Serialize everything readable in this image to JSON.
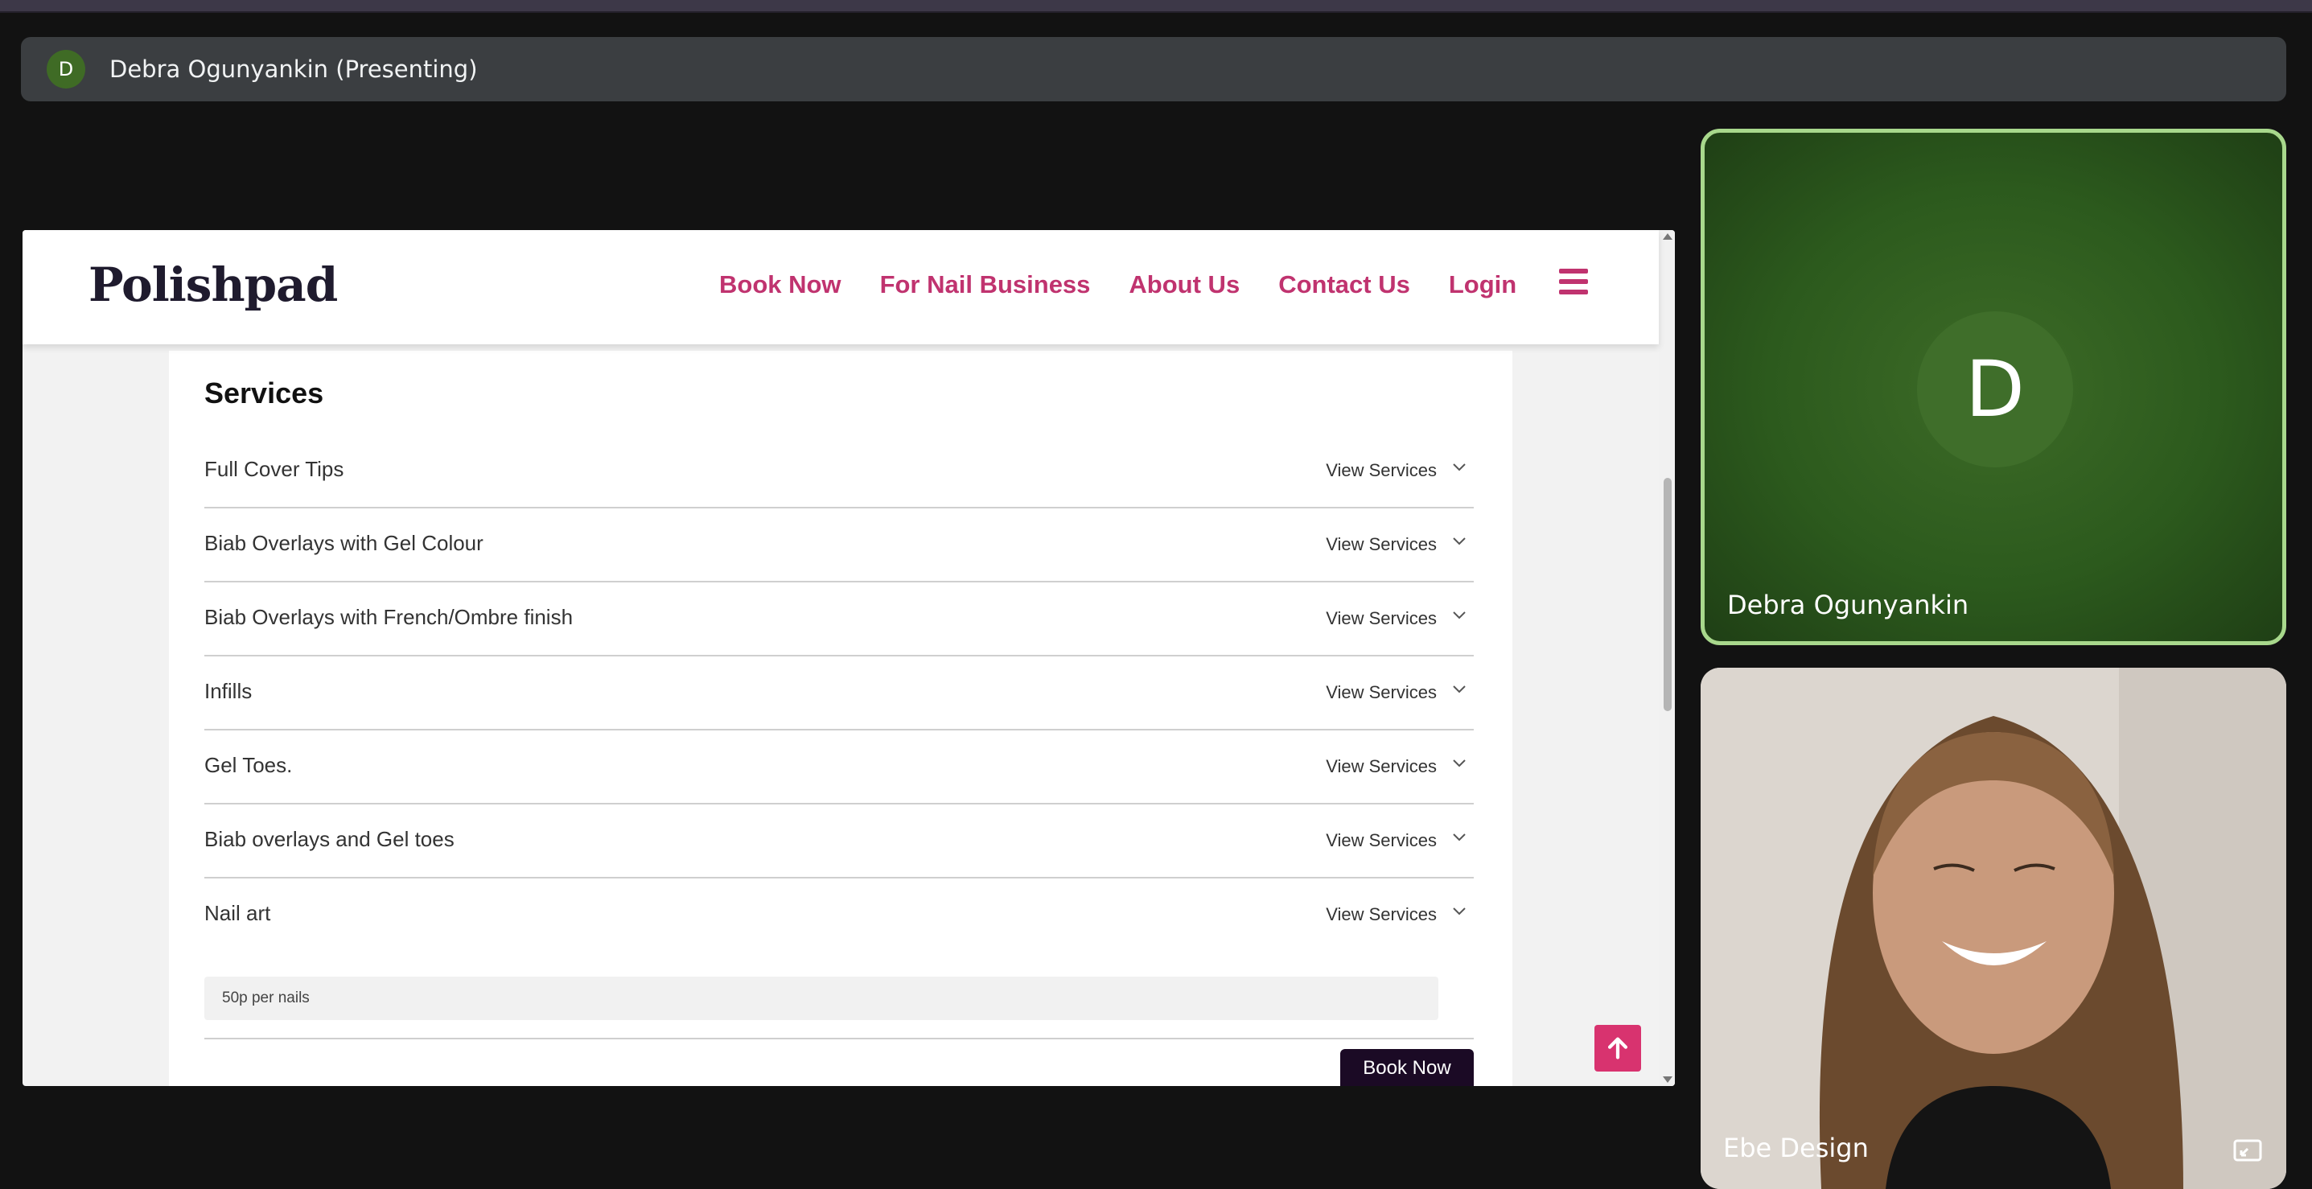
{
  "meeting": {
    "presenter_initial": "D",
    "presenter_label": "Debra Ogunyankin (Presenting)"
  },
  "site": {
    "logo": "Polishpad",
    "nav": [
      "Book Now",
      "For Nail Business",
      "About Us",
      "Contact Us",
      "Login"
    ],
    "services_title": "Services",
    "services": [
      {
        "name": "Full Cover Tips",
        "action": "View Services"
      },
      {
        "name": "Biab Overlays with Gel Colour",
        "action": "View Services"
      },
      {
        "name": "Biab Overlays with French/Ombre finish",
        "action": "View Services"
      },
      {
        "name": "Infills",
        "action": "View Services"
      },
      {
        "name": "Gel Toes.",
        "action": "View Services"
      },
      {
        "name": "Biab overlays and Gel toes",
        "action": "View Services"
      },
      {
        "name": "Nail art",
        "action": "View Services"
      }
    ],
    "nail_art_detail": "50p per nails",
    "book_button": "Book Now"
  },
  "participants": {
    "debra": {
      "initial": "D",
      "name": "Debra Ogunyankin"
    },
    "ebe": {
      "name": "Ebe Design"
    }
  },
  "colors": {
    "accent": "#c0336f",
    "book_button": "#1b0a25",
    "active_speaker_border": "#a8d88c"
  }
}
